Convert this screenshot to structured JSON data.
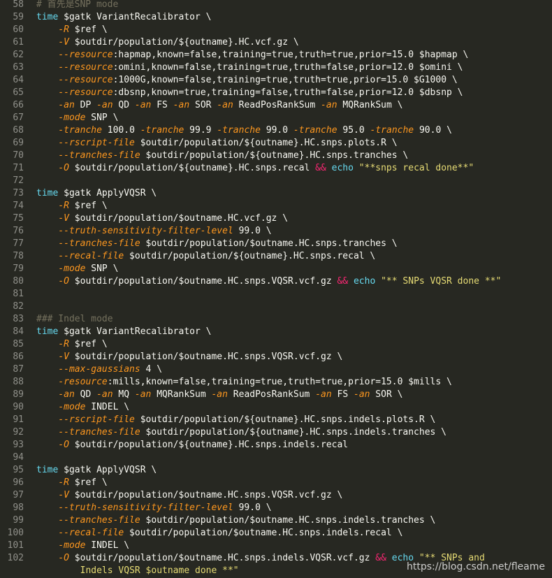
{
  "editor": {
    "theme_colors": {
      "background": "#272822",
      "line_number": "#90908a",
      "text": "#f8f8f2",
      "keyword": "#66d9ef",
      "flag": "#fd971f",
      "operator": "#f92672",
      "string": "#e6db74",
      "comment": "#75715e"
    },
    "lines": [
      {
        "num": "58",
        "tokens": [
          {
            "t": "# 首先是SNP mode",
            "c": "cm"
          }
        ]
      },
      {
        "num": "59",
        "tokens": [
          {
            "t": "time",
            "c": "kw"
          },
          {
            "t": " $gatk VariantRecalibrator \\"
          }
        ]
      },
      {
        "num": "60",
        "tokens": [
          {
            "t": "    "
          },
          {
            "t": "-R",
            "c": "flag"
          },
          {
            "t": " $ref \\"
          }
        ]
      },
      {
        "num": "61",
        "tokens": [
          {
            "t": "    "
          },
          {
            "t": "-V",
            "c": "flag"
          },
          {
            "t": " $outdir/population/${outname}.HC.vcf.gz \\"
          }
        ]
      },
      {
        "num": "62",
        "tokens": [
          {
            "t": "    "
          },
          {
            "t": "--resource",
            "c": "flag"
          },
          {
            "t": ":hapmap,known=false,training=true,truth=true,prior=15.0 $hapmap \\"
          }
        ]
      },
      {
        "num": "63",
        "tokens": [
          {
            "t": "    "
          },
          {
            "t": "--resource",
            "c": "flag"
          },
          {
            "t": ":omini,known=false,training=true,truth=false,prior=12.0 $omini \\"
          }
        ]
      },
      {
        "num": "64",
        "tokens": [
          {
            "t": "    "
          },
          {
            "t": "--resource",
            "c": "flag"
          },
          {
            "t": ":1000G,known=false,training=true,truth=true,prior=15.0 $G1000 \\"
          }
        ]
      },
      {
        "num": "65",
        "tokens": [
          {
            "t": "    "
          },
          {
            "t": "--resource",
            "c": "flag"
          },
          {
            "t": ":dbsnp,known=true,training=false,truth=false,prior=12.0 $dbsnp \\"
          }
        ]
      },
      {
        "num": "66",
        "tokens": [
          {
            "t": "    "
          },
          {
            "t": "-an",
            "c": "flag"
          },
          {
            "t": " DP "
          },
          {
            "t": "-an",
            "c": "flag"
          },
          {
            "t": " QD "
          },
          {
            "t": "-an",
            "c": "flag"
          },
          {
            "t": " FS "
          },
          {
            "t": "-an",
            "c": "flag"
          },
          {
            "t": " SOR "
          },
          {
            "t": "-an",
            "c": "flag"
          },
          {
            "t": " ReadPosRankSum "
          },
          {
            "t": "-an",
            "c": "flag"
          },
          {
            "t": " MQRankSum \\"
          }
        ]
      },
      {
        "num": "67",
        "tokens": [
          {
            "t": "    "
          },
          {
            "t": "-mode",
            "c": "flag"
          },
          {
            "t": " SNP \\"
          }
        ]
      },
      {
        "num": "68",
        "tokens": [
          {
            "t": "    "
          },
          {
            "t": "-tranche",
            "c": "flag"
          },
          {
            "t": " 100.0 "
          },
          {
            "t": "-tranche",
            "c": "flag"
          },
          {
            "t": " 99.9 "
          },
          {
            "t": "-tranche",
            "c": "flag"
          },
          {
            "t": " 99.0 "
          },
          {
            "t": "-tranche",
            "c": "flag"
          },
          {
            "t": " 95.0 "
          },
          {
            "t": "-tranche",
            "c": "flag"
          },
          {
            "t": " 90.0 \\"
          }
        ]
      },
      {
        "num": "69",
        "tokens": [
          {
            "t": "    "
          },
          {
            "t": "--rscript-file",
            "c": "flag"
          },
          {
            "t": " $outdir/population/${outname}.HC.snps.plots.R \\"
          }
        ]
      },
      {
        "num": "70",
        "tokens": [
          {
            "t": "    "
          },
          {
            "t": "--tranches-file",
            "c": "flag"
          },
          {
            "t": " $outdir/population/${outname}.HC.snps.tranches \\"
          }
        ]
      },
      {
        "num": "71",
        "tokens": [
          {
            "t": "    "
          },
          {
            "t": "-O",
            "c": "flag"
          },
          {
            "t": " $outdir/population/${outname}.HC.snps.recal "
          },
          {
            "t": "&&",
            "c": "op"
          },
          {
            "t": " "
          },
          {
            "t": "echo",
            "c": "kw"
          },
          {
            "t": " "
          },
          {
            "t": "\"**snps recal done**\"",
            "c": "str"
          }
        ]
      },
      {
        "num": "72",
        "tokens": []
      },
      {
        "num": "73",
        "tokens": [
          {
            "t": "time",
            "c": "kw"
          },
          {
            "t": " $gatk ApplyVQSR \\"
          }
        ]
      },
      {
        "num": "74",
        "tokens": [
          {
            "t": "    "
          },
          {
            "t": "-R",
            "c": "flag"
          },
          {
            "t": " $ref \\"
          }
        ]
      },
      {
        "num": "75",
        "tokens": [
          {
            "t": "    "
          },
          {
            "t": "-V",
            "c": "flag"
          },
          {
            "t": " $outdir/population/$outname.HC.vcf.gz \\"
          }
        ]
      },
      {
        "num": "76",
        "tokens": [
          {
            "t": "    "
          },
          {
            "t": "--truth-sensitivity-filter-level",
            "c": "flag"
          },
          {
            "t": " 99.0 \\"
          }
        ]
      },
      {
        "num": "77",
        "tokens": [
          {
            "t": "    "
          },
          {
            "t": "--tranches-file",
            "c": "flag"
          },
          {
            "t": " $outdir/population/$outname.HC.snps.tranches \\"
          }
        ]
      },
      {
        "num": "78",
        "tokens": [
          {
            "t": "    "
          },
          {
            "t": "--recal-file",
            "c": "flag"
          },
          {
            "t": " $outdir/population/${outname}.HC.snps.recal \\"
          }
        ]
      },
      {
        "num": "79",
        "tokens": [
          {
            "t": "    "
          },
          {
            "t": "-mode",
            "c": "flag"
          },
          {
            "t": " SNP \\"
          }
        ]
      },
      {
        "num": "80",
        "tokens": [
          {
            "t": "    "
          },
          {
            "t": "-O",
            "c": "flag"
          },
          {
            "t": " $outdir/population/$outname.HC.snps.VQSR.vcf.gz "
          },
          {
            "t": "&&",
            "c": "op"
          },
          {
            "t": " "
          },
          {
            "t": "echo",
            "c": "kw"
          },
          {
            "t": " "
          },
          {
            "t": "\"** SNPs VQSR done **\"",
            "c": "str"
          }
        ]
      },
      {
        "num": "81",
        "tokens": []
      },
      {
        "num": "82",
        "tokens": []
      },
      {
        "num": "83",
        "tokens": [
          {
            "t": "### Indel mode",
            "c": "cm"
          }
        ]
      },
      {
        "num": "84",
        "tokens": [
          {
            "t": "time",
            "c": "kw"
          },
          {
            "t": " $gatk VariantRecalibrator \\"
          }
        ]
      },
      {
        "num": "85",
        "tokens": [
          {
            "t": "    "
          },
          {
            "t": "-R",
            "c": "flag"
          },
          {
            "t": " $ref \\"
          }
        ]
      },
      {
        "num": "86",
        "tokens": [
          {
            "t": "    "
          },
          {
            "t": "-V",
            "c": "flag"
          },
          {
            "t": " $outdir/population/$outname.HC.snps.VQSR.vcf.gz \\"
          }
        ]
      },
      {
        "num": "87",
        "tokens": [
          {
            "t": "    "
          },
          {
            "t": "--max-gaussians",
            "c": "flag"
          },
          {
            "t": " 4 \\"
          }
        ]
      },
      {
        "num": "88",
        "tokens": [
          {
            "t": "    "
          },
          {
            "t": "-resource",
            "c": "flag"
          },
          {
            "t": ":mills,known=false,training=true,truth=true,prior=15.0 $mills \\"
          }
        ]
      },
      {
        "num": "89",
        "tokens": [
          {
            "t": "    "
          },
          {
            "t": "-an",
            "c": "flag"
          },
          {
            "t": " QD "
          },
          {
            "t": "-an",
            "c": "flag"
          },
          {
            "t": " MQ "
          },
          {
            "t": "-an",
            "c": "flag"
          },
          {
            "t": " MQRankSum "
          },
          {
            "t": "-an",
            "c": "flag"
          },
          {
            "t": " ReadPosRankSum "
          },
          {
            "t": "-an",
            "c": "flag"
          },
          {
            "t": " FS "
          },
          {
            "t": "-an",
            "c": "flag"
          },
          {
            "t": " SOR \\"
          }
        ]
      },
      {
        "num": "90",
        "tokens": [
          {
            "t": "    "
          },
          {
            "t": "-mode",
            "c": "flag"
          },
          {
            "t": " INDEL \\"
          }
        ]
      },
      {
        "num": "91",
        "tokens": [
          {
            "t": "    "
          },
          {
            "t": "--rscript-file",
            "c": "flag"
          },
          {
            "t": " $outdir/population/${outname}.HC.snps.indels.plots.R \\"
          }
        ]
      },
      {
        "num": "92",
        "tokens": [
          {
            "t": "    "
          },
          {
            "t": "--tranches-file",
            "c": "flag"
          },
          {
            "t": " $outdir/population/${outname}.HC.snps.indels.tranches \\"
          }
        ]
      },
      {
        "num": "93",
        "tokens": [
          {
            "t": "    "
          },
          {
            "t": "-O",
            "c": "flag"
          },
          {
            "t": " $outdir/population/${outname}.HC.snps.indels.recal"
          }
        ]
      },
      {
        "num": "94",
        "tokens": []
      },
      {
        "num": "95",
        "tokens": [
          {
            "t": "time",
            "c": "kw"
          },
          {
            "t": " $gatk ApplyVQSR \\"
          }
        ]
      },
      {
        "num": "96",
        "tokens": [
          {
            "t": "    "
          },
          {
            "t": "-R",
            "c": "flag"
          },
          {
            "t": " $ref \\"
          }
        ]
      },
      {
        "num": "97",
        "tokens": [
          {
            "t": "    "
          },
          {
            "t": "-V",
            "c": "flag"
          },
          {
            "t": " $outdir/population/$outname.HC.snps.VQSR.vcf.gz \\"
          }
        ]
      },
      {
        "num": "98",
        "tokens": [
          {
            "t": "    "
          },
          {
            "t": "--truth-sensitivity-filter-level",
            "c": "flag"
          },
          {
            "t": " 99.0 \\"
          }
        ]
      },
      {
        "num": "99",
        "tokens": [
          {
            "t": "    "
          },
          {
            "t": "--tranches-file",
            "c": "flag"
          },
          {
            "t": " $outdir/population/$outname.HC.snps.indels.tranches \\"
          }
        ]
      },
      {
        "num": "100",
        "tokens": [
          {
            "t": "    "
          },
          {
            "t": "--recal-file",
            "c": "flag"
          },
          {
            "t": " $outdir/population/$outname.HC.snps.indels.recal \\"
          }
        ]
      },
      {
        "num": "101",
        "tokens": [
          {
            "t": "    "
          },
          {
            "t": "-mode",
            "c": "flag"
          },
          {
            "t": " INDEL \\"
          }
        ]
      },
      {
        "num": "102",
        "tokens": [
          {
            "t": "    "
          },
          {
            "t": "-O",
            "c": "flag"
          },
          {
            "t": " $outdir/population/$outname.HC.snps.indels.VQSR.vcf.gz "
          },
          {
            "t": "&&",
            "c": "op"
          },
          {
            "t": " "
          },
          {
            "t": "echo",
            "c": "kw"
          },
          {
            "t": " "
          },
          {
            "t": "\"** SNPs and",
            "c": "str"
          }
        ]
      },
      {
        "num": "",
        "tokens": [
          {
            "t": "        "
          },
          {
            "t": "Indels VQSR ",
            "c": "str"
          },
          {
            "t": "$outname",
            "c": "str"
          },
          {
            "t": " done **\"",
            "c": "str"
          }
        ]
      }
    ]
  },
  "watermark": {
    "text": "https://blog.csdn.net/fleame"
  }
}
